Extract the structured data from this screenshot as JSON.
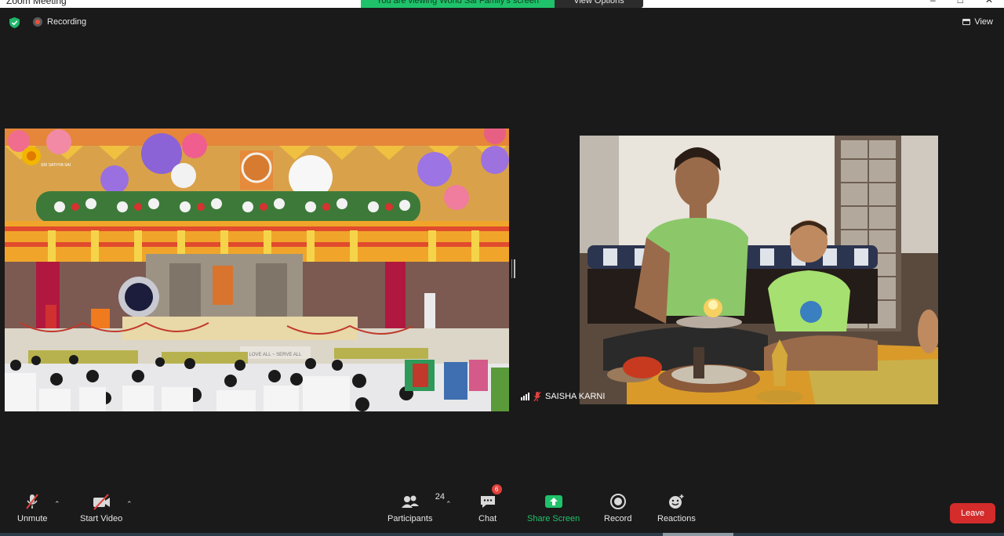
{
  "window": {
    "title": "Zoom Meeting"
  },
  "share_banner": {
    "text": "You are viewing World Sai Family's screen",
    "options_label": "View Options"
  },
  "status": {
    "recording_label": "Recording",
    "view_label": "View"
  },
  "participant": {
    "name": "SAISHA KARNI"
  },
  "stage": {
    "banner_text": "LOVE ALL ~ SERVE ALL",
    "logo_text": "SRI SATHYA SAI"
  },
  "toolbar": {
    "unmute": "Unmute",
    "start_video": "Start Video",
    "participants": "Participants",
    "participants_count": "24",
    "chat": "Chat",
    "chat_badge": "6",
    "share_screen": "Share Screen",
    "record": "Record",
    "reactions": "Reactions",
    "leave": "Leave"
  },
  "colors": {
    "share_green": "#1fc26a",
    "leave_red": "#d42b2b",
    "background": "#1a1a1a"
  }
}
